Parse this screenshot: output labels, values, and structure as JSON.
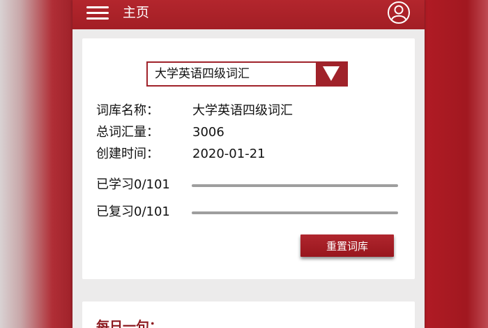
{
  "header": {
    "title": "主页",
    "menu_icon": "hamburger-menu-icon",
    "user_icon": "user-avatar-icon"
  },
  "colors": {
    "primary": "#a0222a",
    "background": "#ecebeb",
    "card": "#ffffff"
  },
  "wordbank": {
    "selected": "大学英语四级词汇",
    "name_label": "词库名称：",
    "name_value": "大学英语四级词汇",
    "total_label": "总词汇量：",
    "total_value": "3006",
    "created_label": "创建时间：",
    "created_value": "2020-01-21"
  },
  "progress": {
    "learned_label": "已学习0/101",
    "learned": 0,
    "learned_total": 101,
    "reviewed_label": "已复习0/101",
    "reviewed": 0,
    "reviewed_total": 101
  },
  "actions": {
    "reset_label": "重置词库"
  },
  "daily": {
    "title": "每日一句："
  }
}
